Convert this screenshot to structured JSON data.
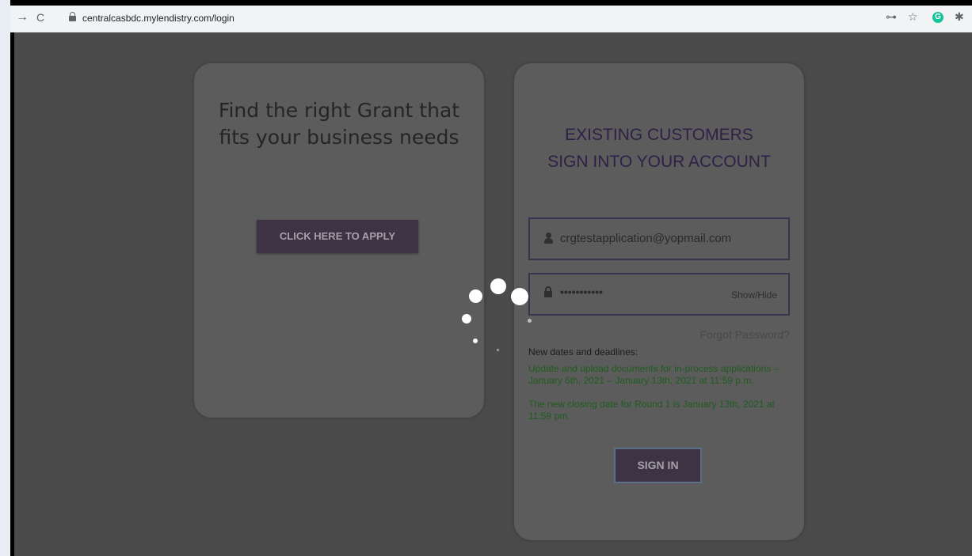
{
  "browser": {
    "url": "centralcasbdc.mylendistry.com/login",
    "back_glyph": "→",
    "reload_glyph": "C",
    "key_glyph": "⊶",
    "star_glyph": "☆",
    "grammarly_glyph": "G",
    "extension_glyph": "✱"
  },
  "left_card": {
    "headline_line1": "Find the right Grant that",
    "headline_line2": "fits your business needs",
    "apply_button": "CLICK HERE TO APPLY"
  },
  "right_card": {
    "heading_line1": "EXISTING CUSTOMERS",
    "heading_line2": "SIGN INTO YOUR ACCOUNT",
    "email_value": "crgtestapplication@yopmail.com",
    "password_mask": "•••••••••••",
    "show_hide": "Show/Hide",
    "forgot_password": "Forgot Password?",
    "notice_title": "New dates and deadlines:",
    "notice_line1": "Update and upload documents for in-process applications – January 6th, 2021 – January 13th, 2021 at 11:59 p.m.",
    "notice_line2": "The new closing date for Round 1 is January 13th, 2021 at 11:59 pm.",
    "signin_button": "SIGN IN"
  },
  "colors": {
    "overlay": "#4b4b4b",
    "accent": "#3e3345",
    "notice_green": "#1e5c1e"
  }
}
